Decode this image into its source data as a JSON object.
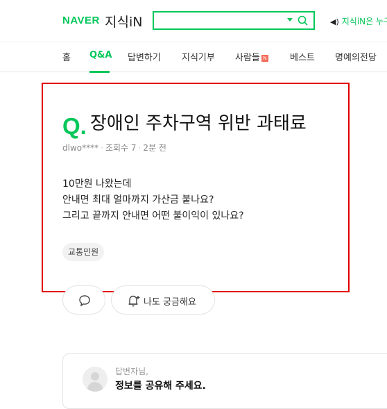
{
  "header": {
    "logo_naver": "NAVER",
    "logo_jisik": "지식iN",
    "search_value": "",
    "promo_text": "지식iN은 누구"
  },
  "nav": {
    "tabs": [
      {
        "label": "홈"
      },
      {
        "label": "Q&A",
        "active": true
      },
      {
        "label": "답변하기"
      },
      {
        "label": "지식기부"
      },
      {
        "label": "사람들",
        "badge": "N"
      },
      {
        "label": "베스트"
      },
      {
        "label": "명예의전당"
      }
    ]
  },
  "question": {
    "q_mark": "Q.",
    "title": "장애인 주차구역 위반 과태료",
    "author": "dlwo****",
    "views": "조회수 7",
    "time": "2분 전",
    "body": [
      "10만원 나왔는데",
      "안내면 최대 얼마까지 가산금 붙나요?",
      "그리고 끝까지 안내면 어떤 불이익이 있나요?"
    ],
    "tag": "교통민원"
  },
  "actions": {
    "curious_label": "나도 궁금해요"
  },
  "answer_card": {
    "answerer": "답변자님,",
    "prompt": "정보를 공유해 주세요."
  },
  "colors": {
    "brand": "#03c75a",
    "highlight": "#e10000",
    "new_badge": "#f26d5b"
  }
}
